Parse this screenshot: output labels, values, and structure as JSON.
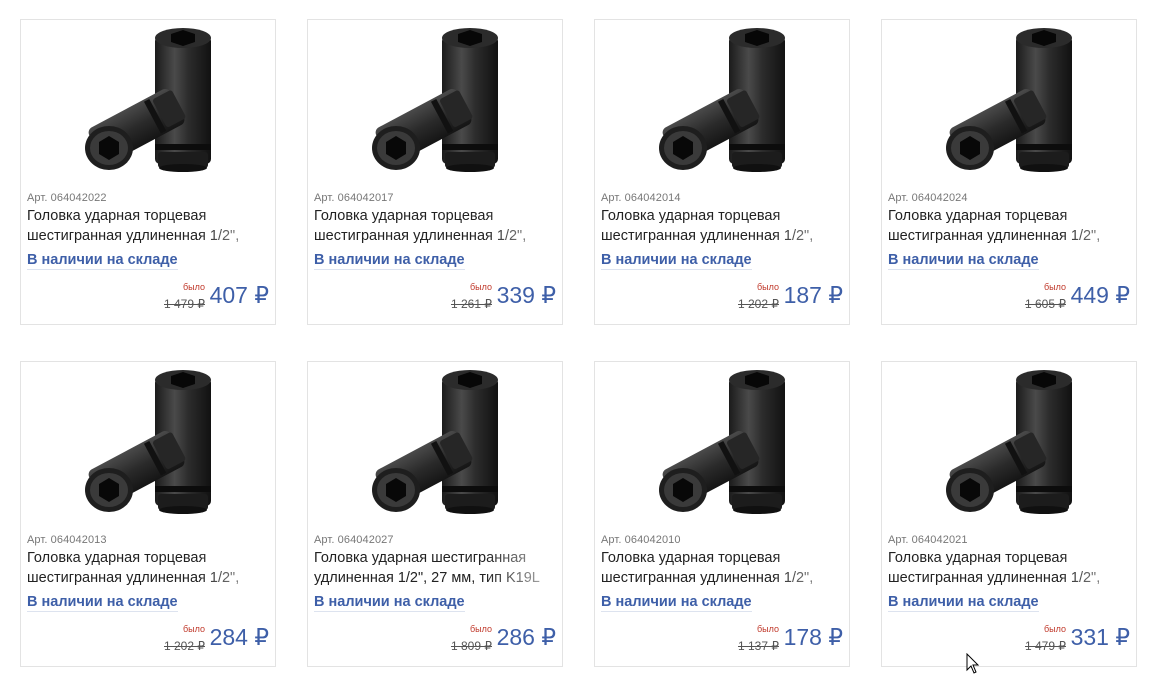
{
  "products": [
    {
      "article": "Арт. 064042022",
      "title": "Головка ударная торцевая шестигранная удлиненная 1/2\",",
      "stock": "В наличии на складе",
      "was_label": "было",
      "old_price": "1 479 ₽",
      "price": "407 ₽"
    },
    {
      "article": "Арт. 064042017",
      "title": "Головка ударная торцевая шестигранная удлиненная 1/2\",",
      "stock": "В наличии на складе",
      "was_label": "было",
      "old_price": "1 261 ₽",
      "price": "339 ₽"
    },
    {
      "article": "Арт. 064042014",
      "title": "Головка ударная торцевая шестигранная удлиненная 1/2\",",
      "stock": "В наличии на складе",
      "was_label": "было",
      "old_price": "1 202 ₽",
      "price": "187 ₽"
    },
    {
      "article": "Арт. 064042024",
      "title": "Головка ударная торцевая шестигранная удлиненная 1/2\",",
      "stock": "В наличии на складе",
      "was_label": "было",
      "old_price": "1 605 ₽",
      "price": "449 ₽"
    },
    {
      "article": "Арт. 064042013",
      "title": "Головка ударная торцевая шестигранная удлиненная 1/2\",",
      "stock": "В наличии на складе",
      "was_label": "было",
      "old_price": "1 202 ₽",
      "price": "284 ₽"
    },
    {
      "article": "Арт. 064042027",
      "title": "Головка ударная шестигранная удлиненная 1/2\", 27 мм, тип K19L",
      "stock": "В наличии на складе",
      "was_label": "было",
      "old_price": "1 809 ₽",
      "price": "286 ₽"
    },
    {
      "article": "Арт. 064042010",
      "title": "Головка ударная торцевая шестигранная удлиненная 1/2\",",
      "stock": "В наличии на складе",
      "was_label": "было",
      "old_price": "1 137 ₽",
      "price": "178 ₽"
    },
    {
      "article": "Арт. 064042021",
      "title": "Головка ударная торцевая шестигранная удлиненная 1/2\",",
      "stock": "В наличии на складе",
      "was_label": "было",
      "old_price": "1 479 ₽",
      "price": "331 ₽"
    }
  ]
}
